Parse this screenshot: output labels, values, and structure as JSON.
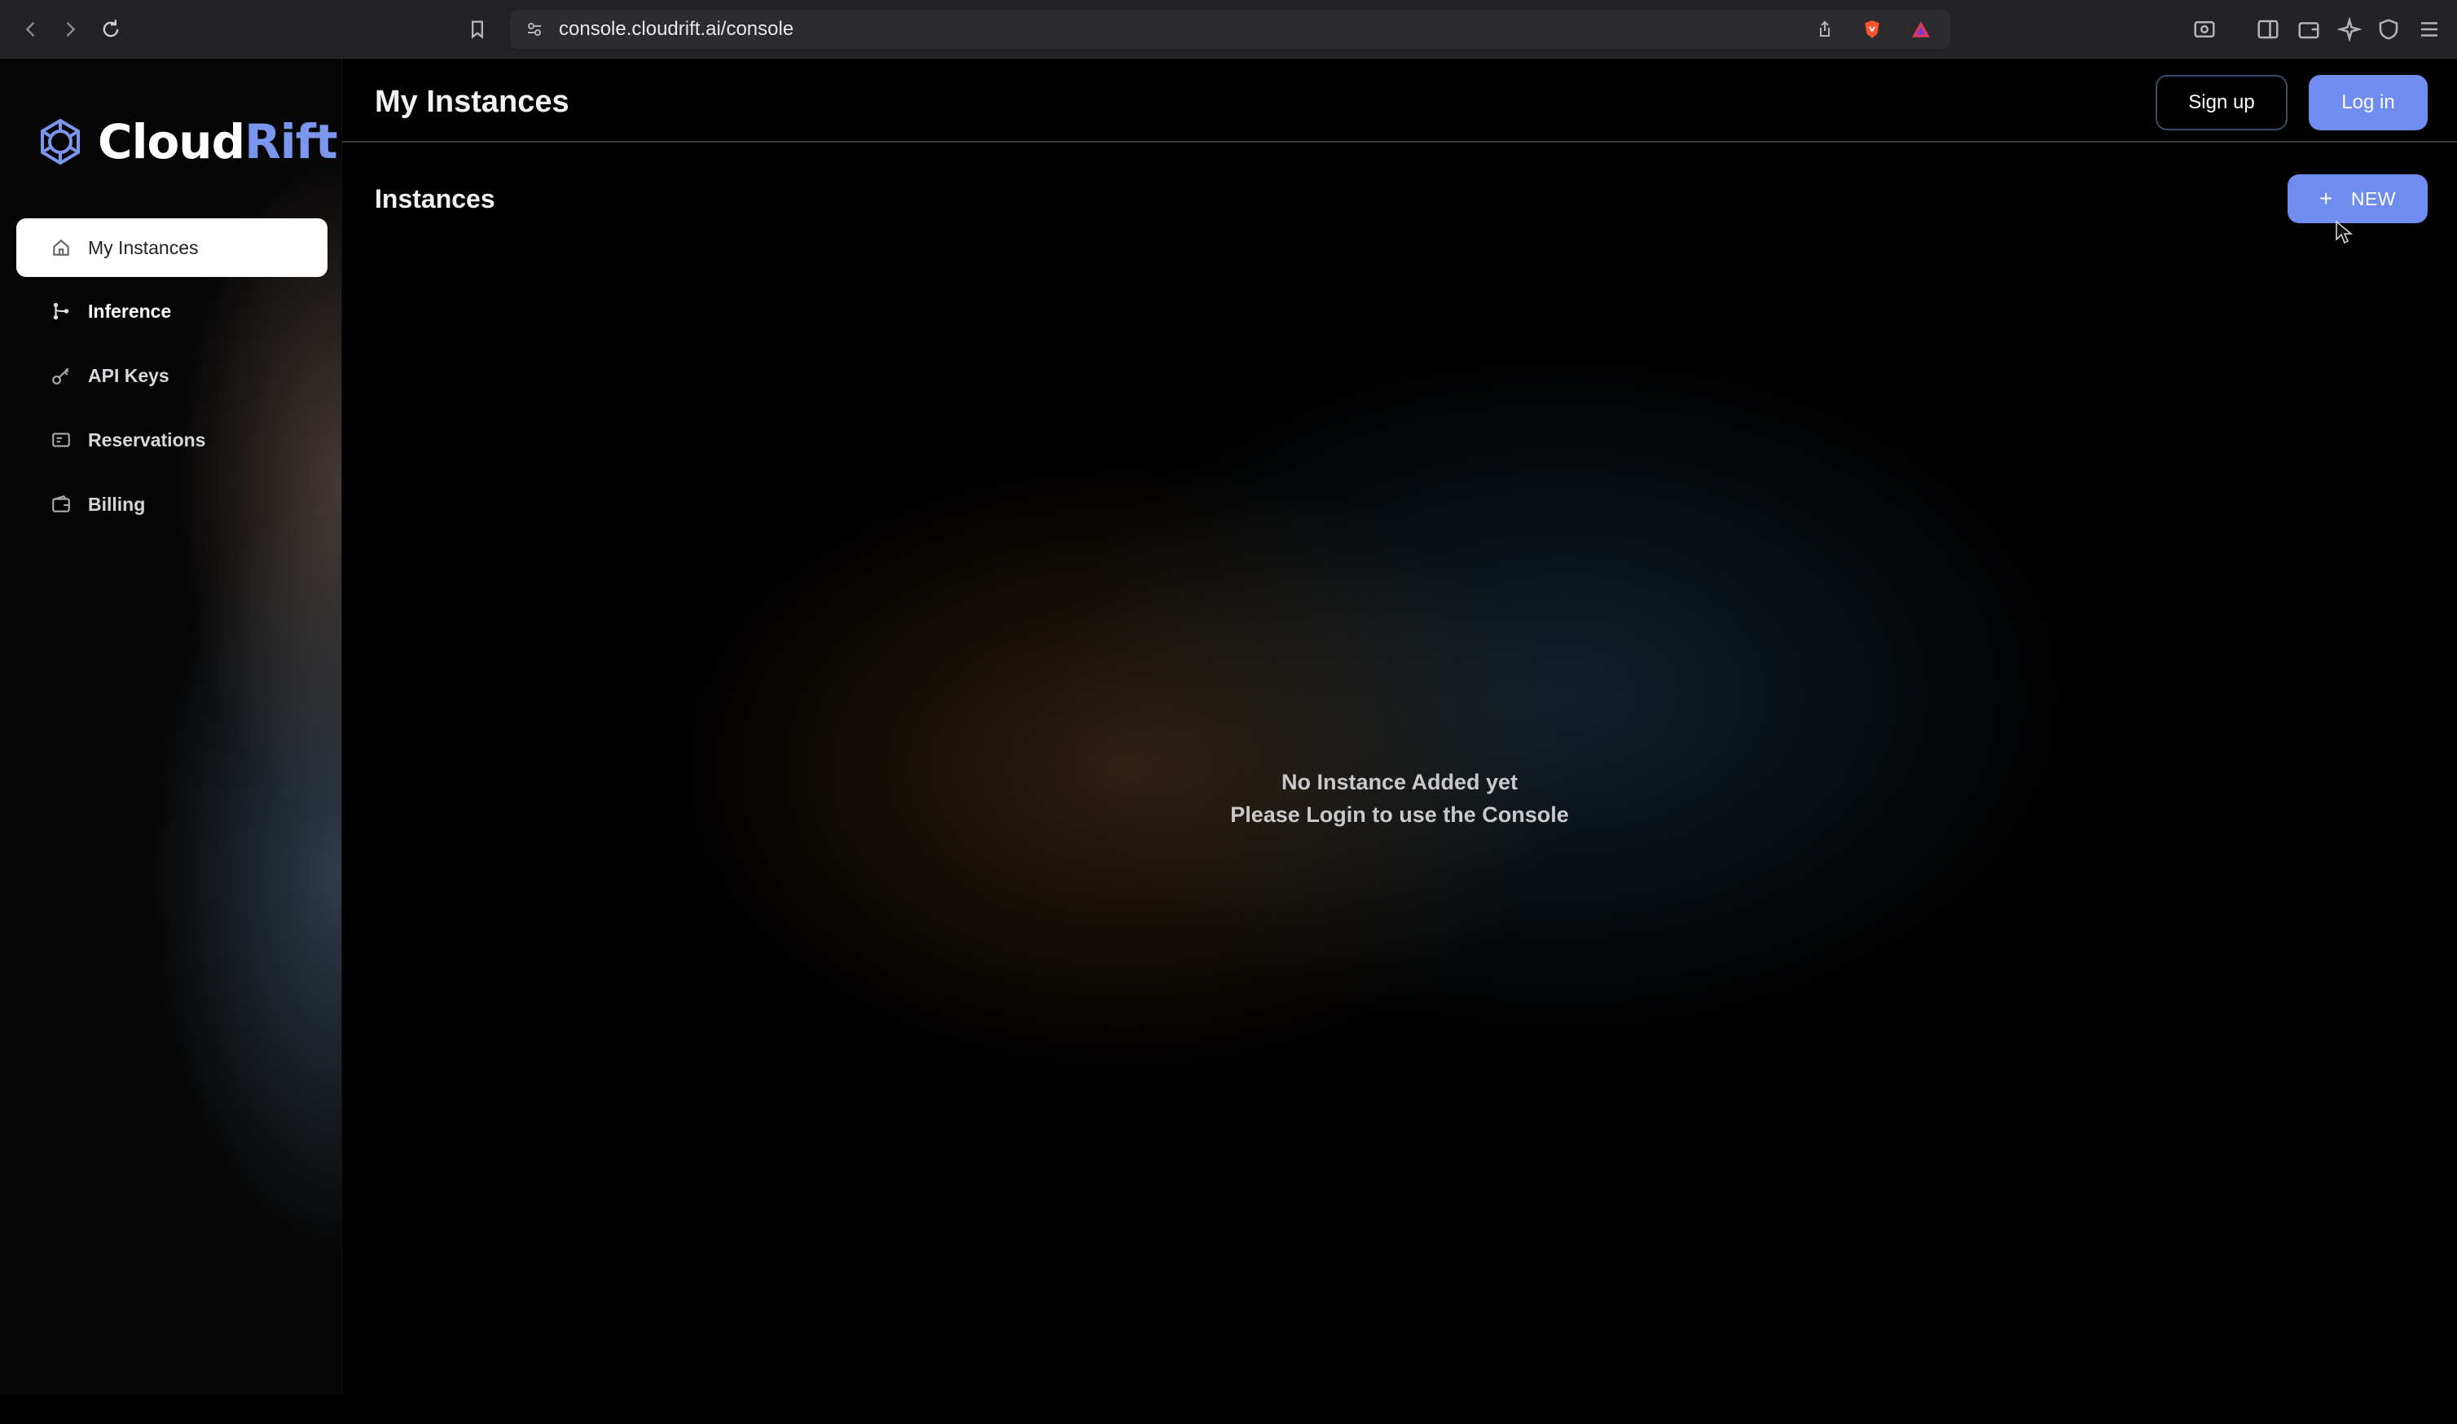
{
  "browser": {
    "url": "console.cloudrift.ai/console"
  },
  "logo": {
    "text_main": "Cloud",
    "text_accent": "Rift",
    "accent_color": "#7b96ee"
  },
  "sidebar": {
    "items": [
      {
        "label": "My Instances",
        "icon": "home-icon",
        "active": true
      },
      {
        "label": "Inference",
        "icon": "branch-icon",
        "active": false
      },
      {
        "label": "API Keys",
        "icon": "key-icon",
        "active": false
      },
      {
        "label": "Reservations",
        "icon": "reservation-icon",
        "active": false
      },
      {
        "label": "Billing",
        "icon": "wallet-icon",
        "active": false
      }
    ]
  },
  "header": {
    "title": "My Instances",
    "signup_label": "Sign up",
    "login_label": "Log in"
  },
  "main": {
    "section_title": "Instances",
    "new_label": "NEW",
    "new_icon": "+",
    "empty_line1": "No Instance Added yet",
    "empty_line2": "Please Login to use the Console"
  },
  "colors": {
    "primary_button": "#6f8df0",
    "background": "#000000"
  }
}
